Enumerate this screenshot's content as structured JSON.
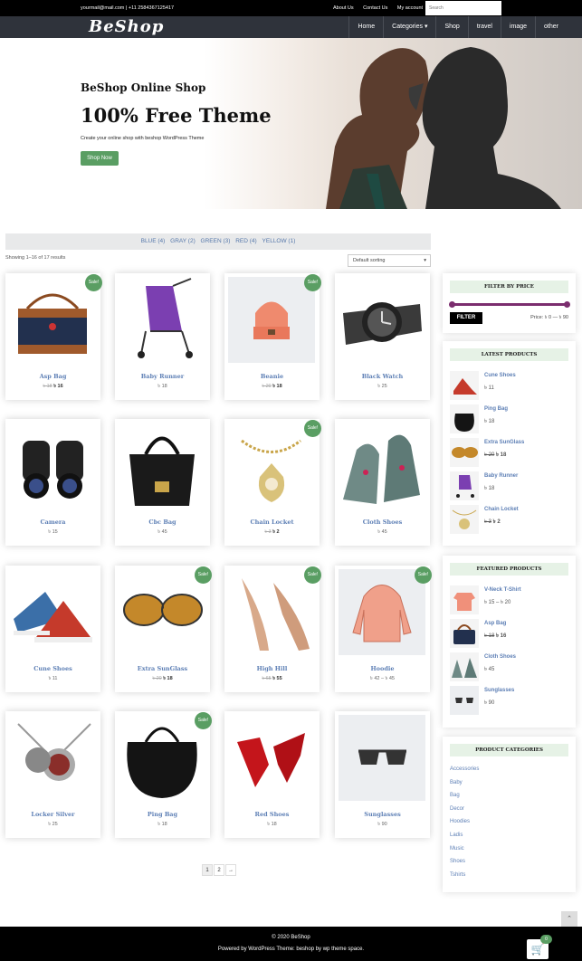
{
  "topbar": {
    "contact": "yourmail@mail.com | +11 2584367125417",
    "links": [
      "About Us",
      "Contact Us",
      "My account"
    ],
    "search_placeholder": "Search"
  },
  "header": {
    "logo": "BeShop",
    "nav": [
      "Home",
      "Categories ▾",
      "Shop",
      "travel",
      "image",
      "other"
    ]
  },
  "hero": {
    "subtitle": "BeShop Online Shop",
    "title": "100% Free Theme",
    "description": "Create your online shop with beshop WordPress Theme",
    "button": "Shop Now"
  },
  "filters": {
    "colors": [
      "BLUE (4)",
      "GRAY (2)",
      "GREEN (3)",
      "RED (4)",
      "YELLOW (1)"
    ]
  },
  "results": {
    "showing": "Showing 1–16 of 17 results",
    "sort": "Default sorting"
  },
  "products": [
    {
      "name": "Asp Bag",
      "old": "৳ 18",
      "new": "৳ 16",
      "sale": "Sale!"
    },
    {
      "name": "Baby Runner",
      "price": "৳ 18"
    },
    {
      "name": "Beanie",
      "old": "৳ 20",
      "new": "৳ 18",
      "sale": "Sale!"
    },
    {
      "name": "Black Watch",
      "price": "৳ 25"
    },
    {
      "name": "Camera",
      "price": "৳ 15"
    },
    {
      "name": "Cbc Bag",
      "price": "৳ 45"
    },
    {
      "name": "Chain Locket",
      "old": "৳ 3",
      "new": "৳ 2",
      "sale": "Sale!"
    },
    {
      "name": "Cloth Shoes",
      "price": "৳ 45"
    },
    {
      "name": "Cune Shoes",
      "price": "৳ 11"
    },
    {
      "name": "Extra SunGlass",
      "old": "৳ 20",
      "new": "৳ 18",
      "sale": "Sale!"
    },
    {
      "name": "High Hill",
      "old": "৳ 65",
      "new": "৳ 55",
      "sale": "Sale!"
    },
    {
      "name": "Hoodie",
      "price": "৳ 42 – ৳ 45",
      "sale": "Sale!"
    },
    {
      "name": "Locker Silver",
      "price": "৳ 25"
    },
    {
      "name": "Ping Bag",
      "price": "৳ 18",
      "sale": "Sale!"
    },
    {
      "name": "Red Shoes",
      "price": "৳ 18"
    },
    {
      "name": "Sunglasses",
      "price": "৳ 90"
    }
  ],
  "pager": [
    "1",
    "2",
    "→"
  ],
  "sidebar": {
    "price_filter": {
      "title": "FILTER BY PRICE",
      "button": "FILTER",
      "range": "Price: ৳ 0 — ৳ 90"
    },
    "latest": {
      "title": "LATEST PRODUCTS",
      "items": [
        {
          "name": "Cune Shoes",
          "price": "৳ 11"
        },
        {
          "name": "Ping Bag",
          "price": "৳ 18"
        },
        {
          "name": "Extra SunGlass",
          "old": "৳ 20",
          "new": "৳ 18"
        },
        {
          "name": "Baby Runner",
          "price": "৳ 18"
        },
        {
          "name": "Chain Locket",
          "old": "৳ 3",
          "new": "৳ 2"
        }
      ]
    },
    "featured": {
      "title": "FEATURED PRODUCTS",
      "items": [
        {
          "name": "V-Neck T-Shirt",
          "price": "৳ 15 – ৳ 20"
        },
        {
          "name": "Asp Bag",
          "old": "৳ 18",
          "new": "৳ 16"
        },
        {
          "name": "Cloth Shoes",
          "price": "৳ 45"
        },
        {
          "name": "Sunglasses",
          "price": "৳ 90"
        }
      ]
    },
    "categories": {
      "title": "PRODUCT CATEGORIES",
      "items": [
        "Accessories",
        "Baby",
        "Bag",
        "Decor",
        "Hoodies",
        "Ladis",
        "Music",
        "Shoes",
        "Tshirts"
      ]
    }
  },
  "footer": {
    "copy": "© 2020 BeShop",
    "credit": "Powered by WordPress Theme: beshop by wp theme space."
  },
  "cart": {
    "count": "0"
  },
  "totop": "⌃"
}
